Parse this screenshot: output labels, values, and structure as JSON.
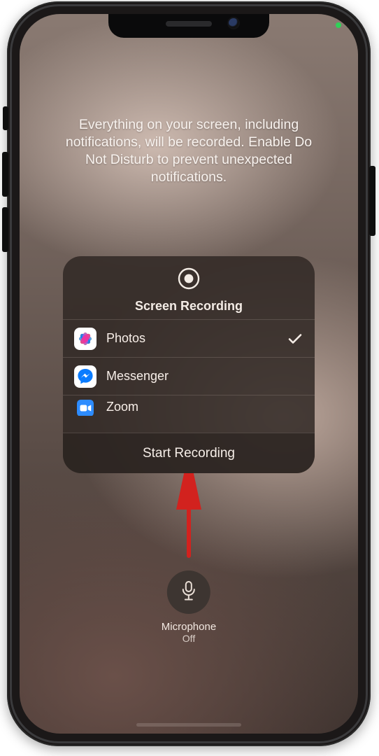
{
  "helper": "Everything on your screen, including notifications, will be recorded. Enable Do Not Disturb to prevent unexpected notifications.",
  "panel": {
    "title": "Screen Recording",
    "apps": [
      {
        "name": "Photos",
        "selected": true,
        "icon": "photos"
      },
      {
        "name": "Messenger",
        "selected": false,
        "icon": "messenger"
      },
      {
        "name": "Zoom",
        "selected": false,
        "icon": "zoom"
      }
    ],
    "start_label": "Start Recording"
  },
  "mic": {
    "label": "Microphone",
    "state": "Off"
  }
}
